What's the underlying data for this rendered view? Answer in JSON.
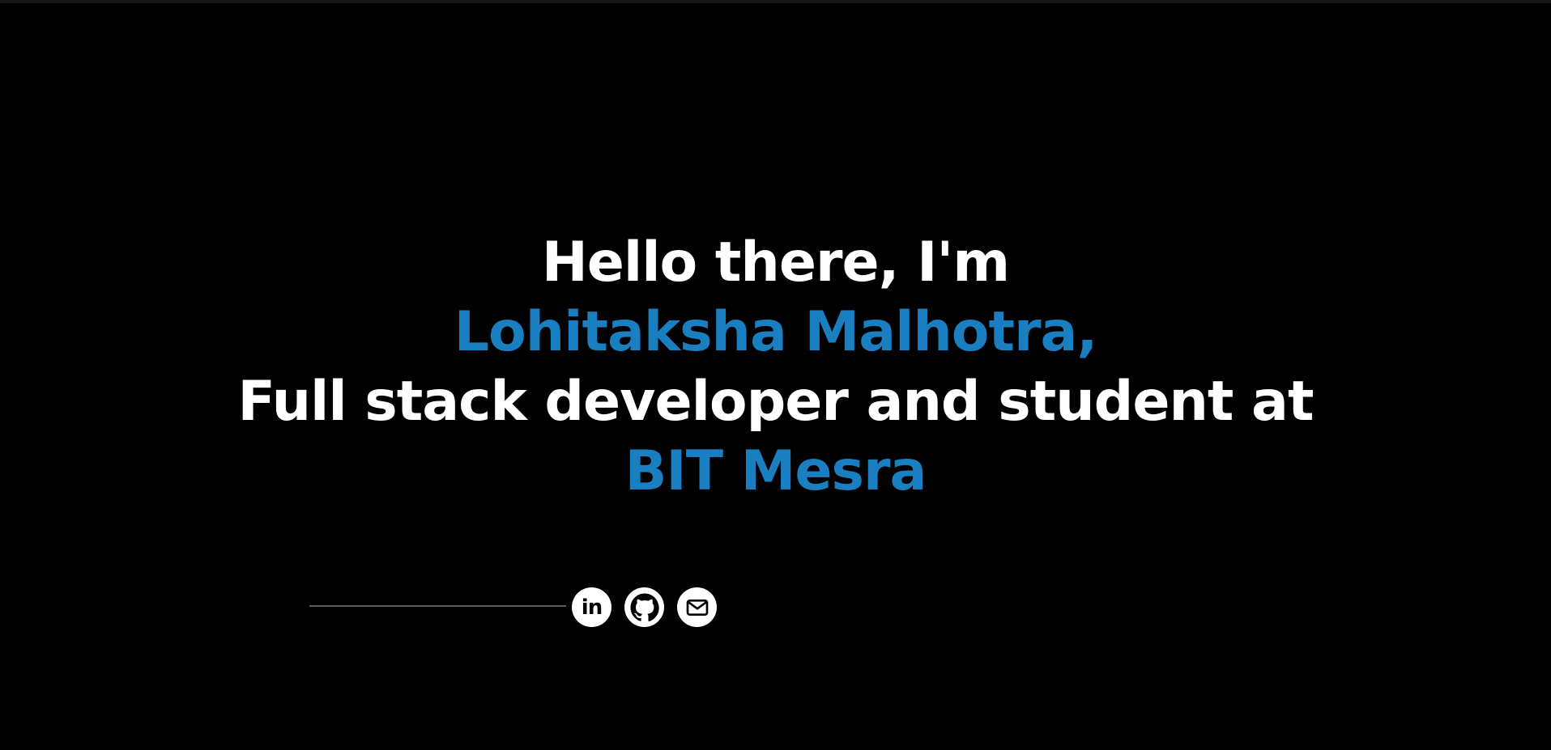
{
  "hero": {
    "greeting": "Hello there, I'm",
    "name": "Lohitaksha Malhotra,",
    "role": "Full stack developer and student at",
    "institution": "BIT Mesra"
  },
  "socials": [
    {
      "icon": "linkedin-icon",
      "label": "in"
    },
    {
      "icon": "github-icon"
    },
    {
      "icon": "mail-icon"
    }
  ],
  "colors": {
    "background": "#000000",
    "text": "#ffffff",
    "accent": "#1a7fc0"
  }
}
